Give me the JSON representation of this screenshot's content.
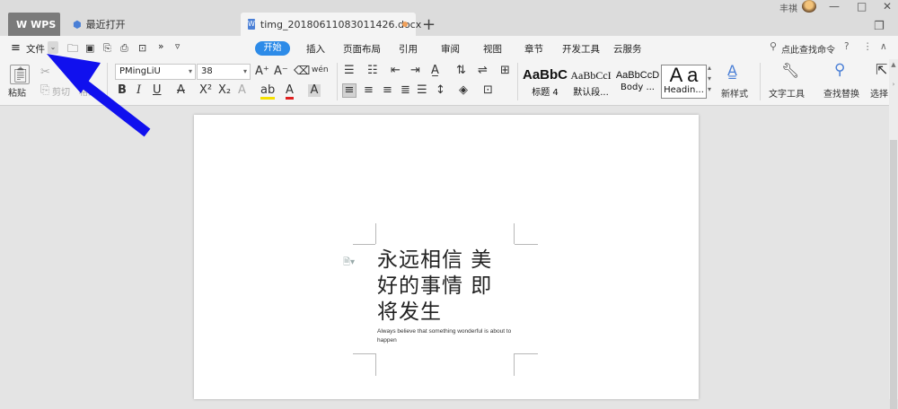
{
  "tabs": {
    "wps": "WPS",
    "recent": "最近打开",
    "doc": "timg_20180611083011426.docx",
    "add": "+"
  },
  "window": {
    "user": "丰祺",
    "minimize": "—",
    "maximize": "□",
    "close": "✕",
    "side_panel": "❐"
  },
  "menu": {
    "hamburger": "≡",
    "file": "文件",
    "more": "»",
    "dropdown": "▿",
    "items": [
      "开始",
      "插入",
      "页面布局",
      "引用",
      "审阅",
      "视图",
      "章节",
      "开发工具",
      "云服务"
    ],
    "search": "点此查找命令",
    "help": "?",
    "kebab": "⋮",
    "collapse": "∧"
  },
  "ribbon": {
    "paste": "粘贴",
    "cut": "剪切",
    "copy": "格式",
    "font_name": "PMingLiU",
    "font_size": "38",
    "styles": [
      {
        "sample": "AaBbC",
        "name": "标题 4"
      },
      {
        "sample": "AaBbCcI",
        "name": "默认段..."
      },
      {
        "sample": "AaBbCcD",
        "name": "Body ..."
      },
      {
        "sample": "A a",
        "name": "Headin..."
      }
    ],
    "new_style": "新样式",
    "text_tools": "文字工具",
    "find_replace": "查找替换",
    "select": "选择"
  },
  "document": {
    "cjk_lines": [
      "永远相信 美",
      "好的事情 即",
      "将发生"
    ],
    "english": "Always believe that something wonderful is about to happen"
  },
  "colors": {
    "accent": "#2d8be8",
    "annotation_arrow": "#1010ee"
  }
}
